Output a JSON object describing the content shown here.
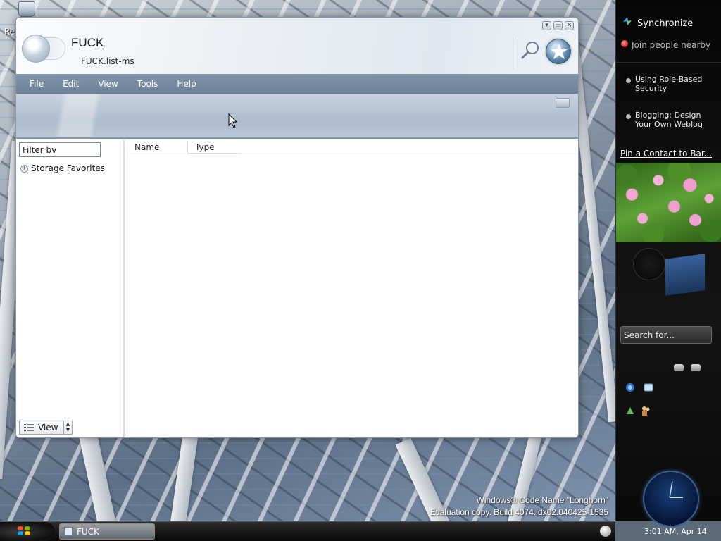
{
  "desktop": {
    "recycle_bin_label": "Rec",
    "watermark_line1": "Windows® Code Name \"Longhorn\"",
    "watermark_line2": "Evaluation copy. Build 4074.idx02.040425-1535"
  },
  "window": {
    "title": "FUCK",
    "subtitle": "FUCK.list-ms",
    "caption_buttons": [
      "minimize",
      "maximize",
      "close"
    ]
  },
  "menu": {
    "items": [
      "File",
      "Edit",
      "View",
      "Tools",
      "Help"
    ]
  },
  "left_pane": {
    "filter_placeholder": "Filter bv",
    "tree": [
      {
        "expander": "+",
        "label": "Storage Favorites"
      }
    ],
    "view_label": "View"
  },
  "list_view": {
    "columns": [
      "Name",
      "Type"
    ]
  },
  "sidebar": {
    "sync_label": "Synchronize",
    "join_label": "Join people nearby",
    "news": [
      {
        "line1": "Using Role-Based",
        "line2": "Security"
      },
      {
        "line1": "Blogging: Design",
        "line2": "Your Own Weblog"
      }
    ],
    "pin_contact": "Pin a Contact to Bar...",
    "search_placeholder": "Search for...",
    "clock_label": "3:01 AM, Apr 14"
  },
  "taskbar": {
    "task_label": "FUCK"
  },
  "colors": {
    "menubar": "#7588a0",
    "sidebar_bg": "#0a0a0a",
    "join_dot": "#d10000",
    "clock_face": "#0b2452"
  },
  "icons": {
    "window_orb": "nav-orb-icon",
    "search": "search-magnifier-icon",
    "favorite": "star-icon",
    "sync": "sync-icon",
    "start": "windows-flag-icon"
  }
}
